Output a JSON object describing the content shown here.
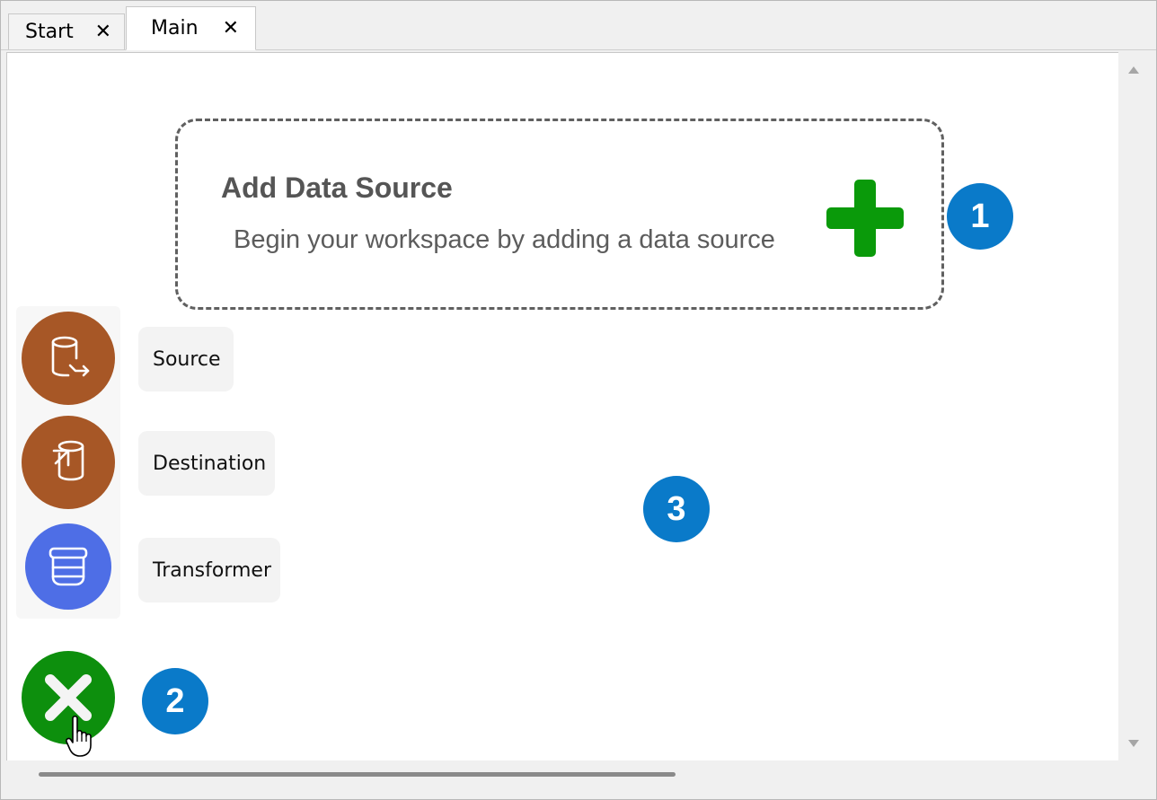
{
  "tabs": [
    {
      "label": "Start",
      "close_glyph": "✕"
    },
    {
      "label": "Main",
      "close_glyph": "✕",
      "active": true
    }
  ],
  "data_source_card": {
    "title": "Add Data Source",
    "subtitle": "Begin your workspace by adding a data source",
    "add_icon": "plus-icon",
    "accent": "#0a9a0a"
  },
  "badges": {
    "one": "1",
    "two": "2",
    "three": "3",
    "color": "#0a7ac9"
  },
  "fab_menu": {
    "items": [
      {
        "label": "Source",
        "icon": "database-export-icon",
        "color": "#a75726"
      },
      {
        "label": "Destination",
        "icon": "database-import-icon",
        "color": "#a75726"
      },
      {
        "label": "Transformer",
        "icon": "transformer-icon",
        "color": "#4e6ee6"
      }
    ],
    "close_button": {
      "icon": "close-icon",
      "color": "#0d8f0d"
    }
  },
  "cursor": "hand-pointer-icon"
}
